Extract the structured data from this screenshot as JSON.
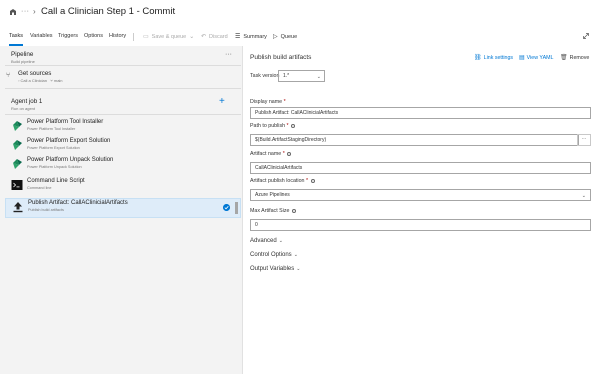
{
  "header": {
    "home_icon": "build-pipeline-icon",
    "more": "···",
    "chevron": "›",
    "title": "Call a Clinician Step 1 - Commit"
  },
  "tabs": [
    {
      "label": "Tasks",
      "active": true
    },
    {
      "label": "Variables"
    },
    {
      "label": "Triggers"
    },
    {
      "label": "Options"
    },
    {
      "label": "History"
    }
  ],
  "toolbar": {
    "save_queue": "Save & queue",
    "discard": "Discard",
    "summary": "Summary",
    "queue": "Queue"
  },
  "pipeline": {
    "title": "Pipeline",
    "subtitle": "Build pipeline",
    "more": "···"
  },
  "sources": {
    "title": "Get sources",
    "repo": "Call a Clinician",
    "branch": "main"
  },
  "agent": {
    "title": "Agent job 1",
    "subtitle": "Run on agent",
    "add": "+"
  },
  "tasks": [
    {
      "name": "Power Platform Tool Installer",
      "sub": "Power Platform Tool Installer",
      "icon": "power-platform-icon"
    },
    {
      "name": "Power Platform Export Solution",
      "sub": "Power Platform Export Solution",
      "icon": "power-platform-icon"
    },
    {
      "name": "Power Platform Unpack Solution",
      "sub": "Power Platform Unpack Solution",
      "icon": "power-platform-icon"
    },
    {
      "name": "Command Line Script",
      "sub": "Command line",
      "icon": "terminal-icon"
    },
    {
      "name": "Publish Artifact: CallAClinicialArtifacts",
      "sub": "Publish build artifacts",
      "icon": "upload-icon",
      "selected": true
    }
  ],
  "details": {
    "title": "Publish build artifacts",
    "link_settings": "Link settings",
    "view_yaml": "View YAML",
    "remove": "Remove",
    "task_version_label": "Task version",
    "task_version": "1.*",
    "display_name_label": "Display name",
    "display_name": "Publish Artifact: CallAClinicialArtifacts",
    "path_label": "Path to publish",
    "path": "$(Build.ArtifactStagingDirectory)",
    "path_btn": "···",
    "artifact_name_label": "Artifact name",
    "artifact_name": "CallAClinicialArtifacts",
    "location_label": "Artifact publish location",
    "location": "Azure Pipelines",
    "max_size_label": "Max Artifact Size",
    "max_size": "0",
    "required_mark": "*",
    "sections": [
      "Advanced",
      "Control Options",
      "Output Variables"
    ]
  },
  "colors": {
    "accent": "#0078d4",
    "left_panel_bg": "#f3f3f3",
    "selected_bg": "#deecf9"
  }
}
